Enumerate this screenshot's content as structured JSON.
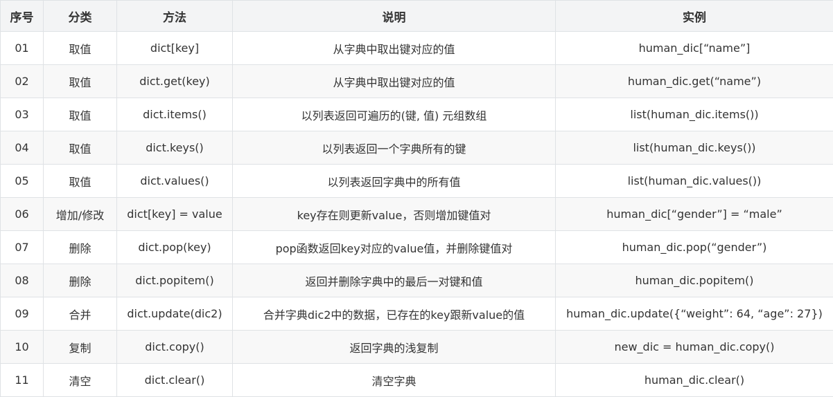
{
  "table": {
    "headers": [
      "序号",
      "分类",
      "方法",
      "说明",
      "实例"
    ],
    "rows": [
      [
        "01",
        "取值",
        "dict[key]",
        "从字典中取出键对应的值",
        "human_dic[“name”]"
      ],
      [
        "02",
        "取值",
        "dict.get(key)",
        "从字典中取出键对应的值",
        "human_dic.get(“name”)"
      ],
      [
        "03",
        "取值",
        "dict.items()",
        "以列表返回可遍历的(键, 值) 元组数组",
        "list(human_dic.items())"
      ],
      [
        "04",
        "取值",
        "dict.keys()",
        "以列表返回一个字典所有的键",
        "list(human_dic.keys())"
      ],
      [
        "05",
        "取值",
        "dict.values()",
        "以列表返回字典中的所有值",
        "list(human_dic.values())"
      ],
      [
        "06",
        "增加/修改",
        "dict[key] = value",
        "key存在则更新value，否则增加键值对",
        "human_dic[“gender”] = “male”"
      ],
      [
        "07",
        "删除",
        "dict.pop(key)",
        "pop函数返回key对应的value值，并删除键值对",
        "human_dic.pop(“gender”)"
      ],
      [
        "08",
        "删除",
        "dict.popitem()",
        "返回并删除字典中的最后一对键和值",
        "human_dic.popitem()"
      ],
      [
        "09",
        "合并",
        "dict.update(dic2)",
        "合并字典dic2中的数据，已存在的key跟新value的值",
        "human_dic.update({“weight”: 64, “age”: 27})"
      ],
      [
        "10",
        "复制",
        "dict.copy()",
        "返回字典的浅复制",
        "new_dic = human_dic.copy()"
      ],
      [
        "11",
        "清空",
        "dict.clear()",
        "清空字典",
        "human_dic.clear()"
      ]
    ]
  }
}
